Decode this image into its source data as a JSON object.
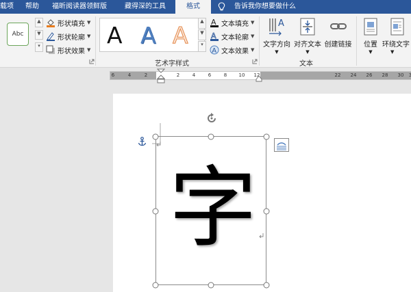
{
  "tabs": [
    {
      "label": "载项",
      "active": false
    },
    {
      "label": "帮助",
      "active": false
    },
    {
      "label": "福昕阅读器领鲜版",
      "active": false
    },
    {
      "label": "藏得深的工具",
      "active": false
    },
    {
      "label": "格式",
      "active": true
    }
  ],
  "tell_me": "告诉我你想要做什么",
  "shape_styles": {
    "sample_label": "Abc",
    "fill": "形状填充",
    "outline": "形状轮廓",
    "effects": "形状效果"
  },
  "wordart": {
    "samples": [
      {
        "letter": "A",
        "style": "plain-black"
      },
      {
        "letter": "A",
        "style": "blue-gradient"
      },
      {
        "letter": "A",
        "style": "orange-outline"
      }
    ],
    "text_fill": "文本填充",
    "text_outline": "文本轮廓",
    "text_effects": "文本效果",
    "group_label": "艺术字样式"
  },
  "text_group": {
    "direction": "文字方向",
    "align": "对齐文本",
    "link": "创建链接",
    "group_label": "文本"
  },
  "arrange": {
    "position": "位置",
    "wrap": "环绕文字"
  },
  "ruler": {
    "labels": [
      "6",
      "4",
      "2",
      "2",
      "4",
      "6",
      "8",
      "10",
      "12",
      "22",
      "24",
      "26",
      "28",
      "30",
      "3"
    ]
  },
  "document": {
    "shape_text": "字"
  },
  "colors": {
    "accent": "#2b579a",
    "ribbon": "#f3f3f3",
    "wordart_blue": "#4f7fbf",
    "wordart_orange": "#f1a672"
  },
  "icons": {
    "anchor": "anchor-icon",
    "rotate": "rotate-handle-icon",
    "layout_options": "layout-options-icon"
  }
}
